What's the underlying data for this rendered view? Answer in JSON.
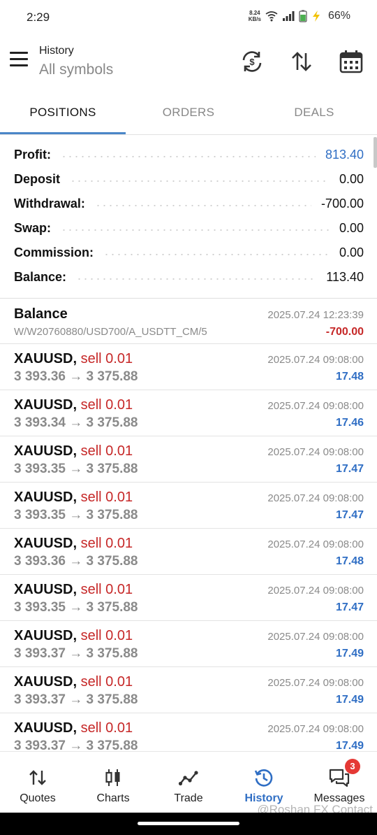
{
  "status_bar": {
    "time": "2:29",
    "net_speed_value": "8.24",
    "net_speed_unit": "KB/s",
    "battery": "66%"
  },
  "header": {
    "title": "History",
    "subtitle": "All symbols",
    "icons": [
      "sync-currency-icon",
      "sort-icon",
      "calendar-icon"
    ]
  },
  "tabs": [
    {
      "label": "POSITIONS",
      "active": true
    },
    {
      "label": "ORDERS",
      "active": false
    },
    {
      "label": "DEALS",
      "active": false
    }
  ],
  "summary": [
    {
      "label": "Profit:",
      "value": "813.40",
      "color": "#2f6ec4"
    },
    {
      "label": "Deposit",
      "value": "0.00"
    },
    {
      "label": "Withdrawal:",
      "value": "-700.00"
    },
    {
      "label": "Swap:",
      "value": "0.00"
    },
    {
      "label": "Commission:",
      "value": "0.00"
    },
    {
      "label": "Balance:",
      "value": "113.40"
    }
  ],
  "balance_entry": {
    "title": "Balance",
    "reference": "W/W20760880/USD700/A_USDTT_CM/5",
    "datetime": "2025.07.24 12:23:39",
    "amount": "-700.00"
  },
  "trades": [
    {
      "symbol": "XAUUSD,",
      "side": "sell 0.01",
      "prices": "3 393.36 → 3 375.88",
      "datetime": "2025.07.24 09:08:00",
      "profit": "17.48"
    },
    {
      "symbol": "XAUUSD,",
      "side": "sell 0.01",
      "prices": "3 393.34 → 3 375.88",
      "datetime": "2025.07.24 09:08:00",
      "profit": "17.46"
    },
    {
      "symbol": "XAUUSD,",
      "side": "sell 0.01",
      "prices": "3 393.35 → 3 375.88",
      "datetime": "2025.07.24 09:08:00",
      "profit": "17.47"
    },
    {
      "symbol": "XAUUSD,",
      "side": "sell 0.01",
      "prices": "3 393.35 → 3 375.88",
      "datetime": "2025.07.24 09:08:00",
      "profit": "17.47"
    },
    {
      "symbol": "XAUUSD,",
      "side": "sell 0.01",
      "prices": "3 393.36 → 3 375.88",
      "datetime": "2025.07.24 09:08:00",
      "profit": "17.48"
    },
    {
      "symbol": "XAUUSD,",
      "side": "sell 0.01",
      "prices": "3 393.35 → 3 375.88",
      "datetime": "2025.07.24 09:08:00",
      "profit": "17.47"
    },
    {
      "symbol": "XAUUSD,",
      "side": "sell 0.01",
      "prices": "3 393.37 → 3 375.88",
      "datetime": "2025.07.24 09:08:00",
      "profit": "17.49"
    },
    {
      "symbol": "XAUUSD,",
      "side": "sell 0.01",
      "prices": "3 393.37 → 3 375.88",
      "datetime": "2025.07.24 09:08:00",
      "profit": "17.49"
    },
    {
      "symbol": "XAUUSD,",
      "side": "sell 0.01",
      "prices": "3 393.37 → 3 375.88",
      "datetime": "2025.07.24 09:08:00",
      "profit": "17.49"
    }
  ],
  "bottom_nav": [
    {
      "label": "Quotes",
      "icon": "quotes-arrows-icon",
      "active": false
    },
    {
      "label": "Charts",
      "icon": "candlestick-icon",
      "active": false
    },
    {
      "label": "Trade",
      "icon": "trend-line-icon",
      "active": false
    },
    {
      "label": "History",
      "icon": "history-clock-icon",
      "active": true
    },
    {
      "label": "Messages",
      "icon": "chat-bubbles-icon",
      "active": false,
      "badge": "3"
    }
  ],
  "watermark": "@Roshan FX Contact",
  "colors": {
    "accent_blue": "#2f6ec4",
    "sell_red": "#c62828",
    "badge_red": "#e53935",
    "tab_indicator": "#4a86c8"
  }
}
